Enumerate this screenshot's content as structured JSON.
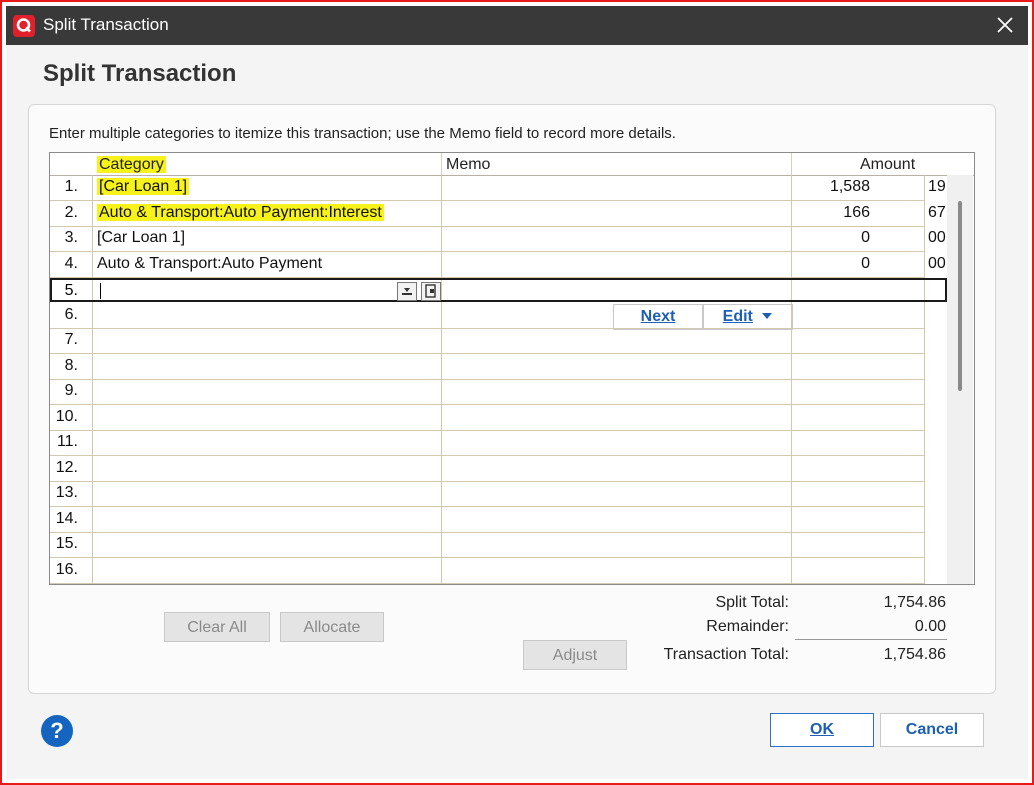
{
  "window": {
    "title": "Split Transaction",
    "close_icon": "close-icon"
  },
  "dialog": {
    "heading": "Split Transaction",
    "instructions": "Enter multiple categories to itemize this transaction; use the Memo field to record more details."
  },
  "grid": {
    "columns": {
      "category": "Category",
      "memo": "Memo",
      "amount": "Amount"
    },
    "rows": [
      {
        "num": "1.",
        "category": "[Car Loan 1]",
        "memo": "",
        "amount": "1,588",
        "cents": "19",
        "highlight": true
      },
      {
        "num": "2.",
        "category": "Auto & Transport:Auto Payment:Interest",
        "memo": "",
        "amount": "166",
        "cents": "67",
        "highlight": true
      },
      {
        "num": "3.",
        "category": "[Car Loan 1]",
        "memo": "",
        "amount": "0",
        "cents": "00",
        "highlight": false
      },
      {
        "num": "4.",
        "category": "Auto & Transport:Auto Payment",
        "memo": "",
        "amount": "0",
        "cents": "00",
        "highlight": false
      },
      {
        "num": "5.",
        "category": "",
        "memo": "",
        "amount": "",
        "cents": ""
      },
      {
        "num": "6.",
        "category": "",
        "memo": "",
        "amount": "",
        "cents": ""
      },
      {
        "num": "7.",
        "category": "",
        "memo": "",
        "amount": "",
        "cents": ""
      },
      {
        "num": "8.",
        "category": "",
        "memo": "",
        "amount": "",
        "cents": ""
      },
      {
        "num": "9.",
        "category": "",
        "memo": "",
        "amount": "",
        "cents": ""
      },
      {
        "num": "10.",
        "category": "",
        "memo": "",
        "amount": "",
        "cents": ""
      },
      {
        "num": "11.",
        "category": "",
        "memo": "",
        "amount": "",
        "cents": ""
      },
      {
        "num": "12.",
        "category": "",
        "memo": "",
        "amount": "",
        "cents": ""
      },
      {
        "num": "13.",
        "category": "",
        "memo": "",
        "amount": "",
        "cents": ""
      },
      {
        "num": "14.",
        "category": "",
        "memo": "",
        "amount": "",
        "cents": ""
      },
      {
        "num": "15.",
        "category": "",
        "memo": "",
        "amount": "",
        "cents": ""
      },
      {
        "num": "16.",
        "category": "",
        "memo": "",
        "amount": "",
        "cents": ""
      }
    ],
    "inline_actions": {
      "next": "Next",
      "edit": "Edit"
    }
  },
  "buttons": {
    "clear_all": "Clear All",
    "allocate": "Allocate",
    "adjust": "Adjust",
    "ok": "OK",
    "cancel": "Cancel",
    "help": "?"
  },
  "totals": {
    "split_total_label": "Split Total:",
    "split_total_value": "1,754.86",
    "remainder_label": "Remainder:",
    "remainder_value": "0.00",
    "transaction_total_label": "Transaction Total:",
    "transaction_total_value": "1,754.86"
  },
  "colors": {
    "highlight": "#f7f31a",
    "titlebar": "#393939",
    "accent": "#1d5fb3",
    "frame": "#e81919"
  }
}
